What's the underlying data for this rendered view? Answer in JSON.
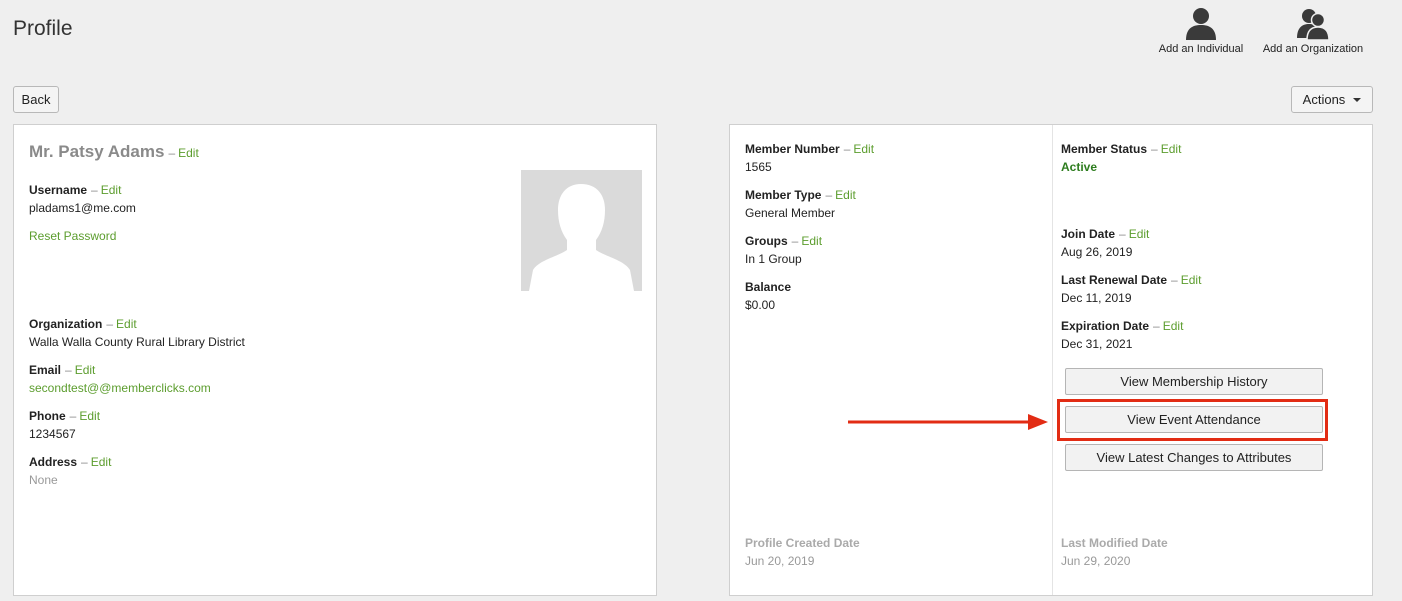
{
  "header": {
    "title": "Profile",
    "add_individual": "Add an Individual",
    "add_organization": "Add an Organization"
  },
  "toolbar": {
    "back_label": "Back",
    "actions_label": "Actions"
  },
  "left": {
    "name": "Mr. Patsy Adams",
    "edit": "Edit",
    "dash": "–",
    "username": {
      "label": "Username",
      "value": "pladams1@me.com"
    },
    "reset_password": "Reset Password",
    "organization": {
      "label": "Organization",
      "value": "Walla Walla County Rural Library District"
    },
    "email": {
      "label": "Email",
      "value": "secondtest@@memberclicks.com"
    },
    "phone": {
      "label": "Phone",
      "value": "1234567"
    },
    "address": {
      "label": "Address",
      "value": "None"
    }
  },
  "right": {
    "member_number": {
      "label": "Member Number",
      "value": "1565"
    },
    "member_type": {
      "label": "Member Type",
      "value": "General Member"
    },
    "groups": {
      "label": "Groups",
      "value": "In 1 Group"
    },
    "balance": {
      "label": "Balance",
      "value": "$0.00"
    },
    "member_status": {
      "label": "Member Status",
      "value": "Active"
    },
    "join_date": {
      "label": "Join Date",
      "value": "Aug 26, 2019"
    },
    "last_renewal": {
      "label": "Last Renewal Date",
      "value": "Dec 11, 2019"
    },
    "expiration": {
      "label": "Expiration Date",
      "value": "Dec 31, 2021"
    },
    "buttons": {
      "membership_history": "View Membership History",
      "event_attendance": "View Event Attendance",
      "latest_changes": "View Latest Changes to Attributes"
    },
    "created": {
      "label": "Profile Created Date",
      "value": "Jun 20, 2019"
    },
    "modified": {
      "label": "Last Modified Date",
      "value": "Jun 29, 2020"
    }
  },
  "colors": {
    "edit_link": "#5c9d2e",
    "active_status": "#2e7d1f",
    "highlight": "#e22c14"
  },
  "icons": {
    "add_individual": "person-icon",
    "add_organization": "people-icon",
    "avatar": "silhouette-icon"
  }
}
